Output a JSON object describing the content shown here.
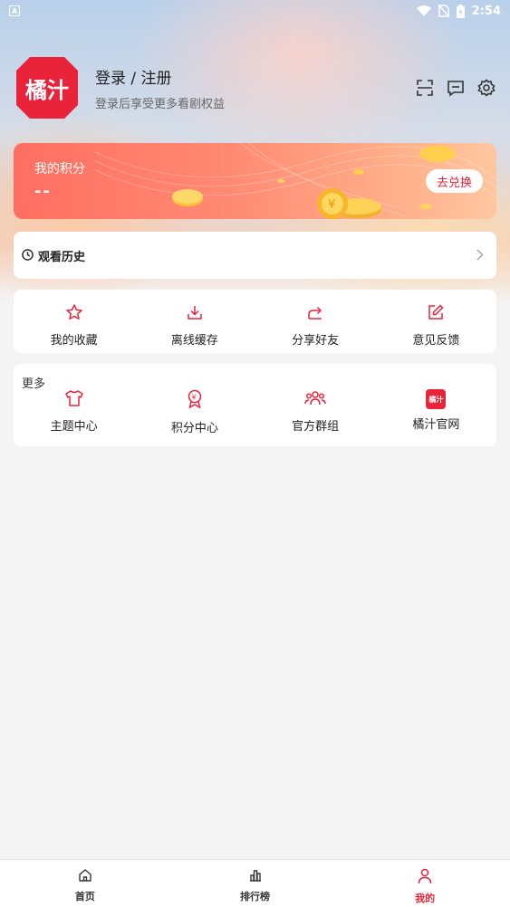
{
  "statusbar": {
    "time": "2:54",
    "left_badge": "A"
  },
  "profile": {
    "logo_text": "橘汁",
    "title": "登录 / 注册",
    "subtitle": "登录后享受更多看剧权益"
  },
  "points": {
    "title": "我的积分",
    "value": "--",
    "redeem_label": "去兑换"
  },
  "history": {
    "label": "观看历史"
  },
  "quick_actions": [
    {
      "label": "我的收藏",
      "icon": "star-icon"
    },
    {
      "label": "离线缓存",
      "icon": "download-icon"
    },
    {
      "label": "分享好友",
      "icon": "share-icon"
    },
    {
      "label": "意见反馈",
      "icon": "edit-icon"
    }
  ],
  "more": {
    "title": "更多",
    "items": [
      {
        "label": "主题中心",
        "icon": "tshirt-icon"
      },
      {
        "label": "积分中心",
        "icon": "medal-icon"
      },
      {
        "label": "官方群组",
        "icon": "group-icon"
      },
      {
        "label": "橘汁官网",
        "icon": "brand-logo-icon",
        "logo_text": "橘汁"
      }
    ]
  },
  "bottom_nav": [
    {
      "label": "首页",
      "icon": "home-icon",
      "active": false
    },
    {
      "label": "排行榜",
      "icon": "chart-icon",
      "active": false
    },
    {
      "label": "我的",
      "icon": "person-icon",
      "active": true
    }
  ],
  "colors": {
    "accent": "#e8233a",
    "points_start": "#ff6f61",
    "points_end": "#ffc7a1"
  }
}
